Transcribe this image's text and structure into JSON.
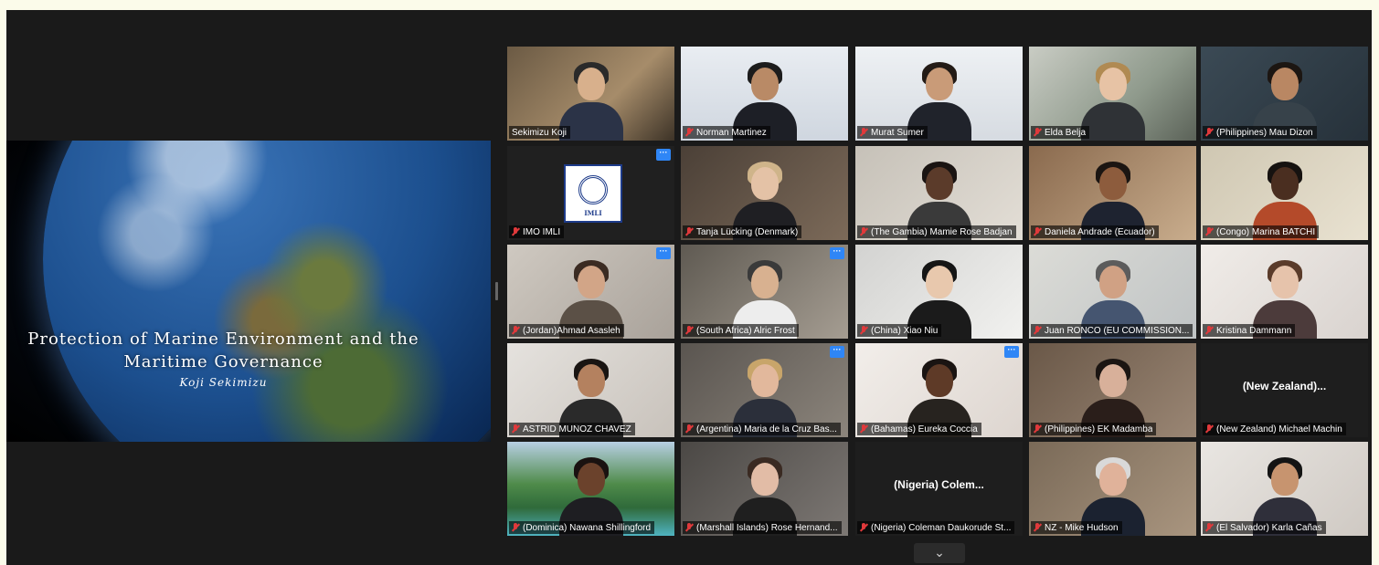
{
  "shared_screen": {
    "title_line1": "Protection of Marine Environment and the",
    "title_line2": "Maritime Governance",
    "author": "Koji Sekimizu"
  },
  "colors": {
    "app_background": "#1a1a1a",
    "active_speaker_border": "#d4e36b",
    "muted_icon": "#e0393b",
    "more_button": "#2f86f6"
  },
  "icons": {
    "muted": "microphone-muted-icon",
    "more": "ellipsis-icon",
    "nav": "chevron-down-icon"
  },
  "more_button_label": "···",
  "nav_glyph": "⌄",
  "participants": [
    {
      "name": "Sekimizu Koji",
      "muted": false,
      "active": true
    },
    {
      "name": "Norman Martinez",
      "muted": true
    },
    {
      "name": "Murat Sumer",
      "muted": true
    },
    {
      "name": "Elda Belja",
      "muted": true
    },
    {
      "name": "(Philippines) Mau Dizon",
      "muted": true
    },
    {
      "name": "IMO IMLI",
      "muted": true,
      "logo_text": "IMLI",
      "more": true
    },
    {
      "name": "Tanja Lücking (Denmark)",
      "muted": true
    },
    {
      "name": "(The Gambia) Mamie Rose Badjan",
      "muted": true
    },
    {
      "name": "Daniela Andrade (Ecuador)",
      "muted": true
    },
    {
      "name": "(Congo) Marina BATCHI",
      "muted": true
    },
    {
      "name": "(Jordan)Ahmad Asasleh",
      "muted": true,
      "more": true
    },
    {
      "name": "(South Africa) Alric Frost",
      "muted": true,
      "more": true
    },
    {
      "name": "(China) Xiao Niu",
      "muted": true
    },
    {
      "name": "Juan RONCO (EU COMMISSION...",
      "muted": true
    },
    {
      "name": "Kristina Dammann",
      "muted": true
    },
    {
      "name": "ASTRID MUÑOZ CHAVEZ",
      "muted": true
    },
    {
      "name": "(Argentina) Maria de la Cruz Bas...",
      "muted": true,
      "more": true
    },
    {
      "name": "(Bahamas) Eureka Coccia",
      "muted": true,
      "more": true
    },
    {
      "name": "(Philippines) EK Madamba",
      "muted": true
    },
    {
      "name": "(New Zealand) Michael Machin",
      "muted": true,
      "center_name": "(New Zealand)..."
    },
    {
      "name": "(Dominica) Nawana Shillingford",
      "muted": true
    },
    {
      "name": "(Marshall Islands) Rose Hernand...",
      "muted": true
    },
    {
      "name": "(Nigeria) Coleman Daukorude St...",
      "muted": true,
      "center_name": "(Nigeria)  Colem..."
    },
    {
      "name": "NZ - Mike Hudson",
      "muted": true
    },
    {
      "name": "(El Salvador) Karla Cañas",
      "muted": true
    }
  ]
}
